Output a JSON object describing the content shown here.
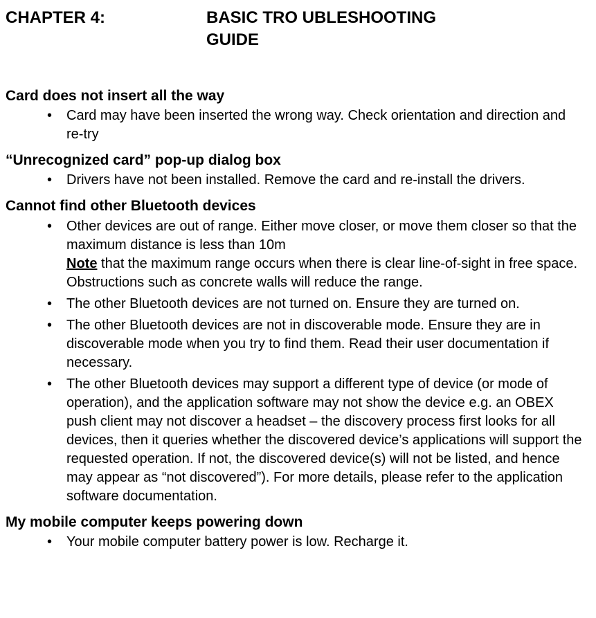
{
  "chapter": {
    "label": "CHAPTER 4:",
    "title_line1": "BASIC TRO UBLESHOOTING",
    "title_line2": "GUIDE"
  },
  "sections": {
    "s1": {
      "heading": "Card does not insert all the way",
      "b1": "Card may have been inserted the wrong way.  Check orientation and direction and re-try"
    },
    "s2": {
      "heading": "“Unrecognized card” pop-up dialog box",
      "b1": "Drivers have not been installed.  Remove the card and re-install the drivers."
    },
    "s3": {
      "heading": "Cannot find other Bluetooth devices",
      "b1a": "Other devices are out of range.  Either move closer, or move them closer so that the maximum distance is less than 10m",
      "b1_note_label": "Note",
      "b1b": " that the maximum range occurs when there is clear line-of-sight in free space.  Obstructions such as concrete walls will reduce the range.",
      "b2": "The other Bluetooth devices are not turned on.  Ensure they are turned on.",
      "b3": "The other Bluetooth devices are not in discoverable mode.  Ensure they are in discoverable mode when you try to find them.  Read their user documentation if necessary.",
      "b4": "The other Bluetooth devices may support a different type of device (or mode of operation), and the application software may not show the device e.g. an OBEX push client may not discover a headset – the discovery process first looks for all devices, then it queries whether the discovered device’s applications will support the requested operation.  If not, the discovered device(s) will not be listed, and hence may appear as “not discovered”).  For more details, please refer to the application software documentation."
    },
    "s4": {
      "heading": "My mobile computer keeps powering down",
      "b1": "Your mobile computer battery power is low.  Recharge it."
    }
  }
}
